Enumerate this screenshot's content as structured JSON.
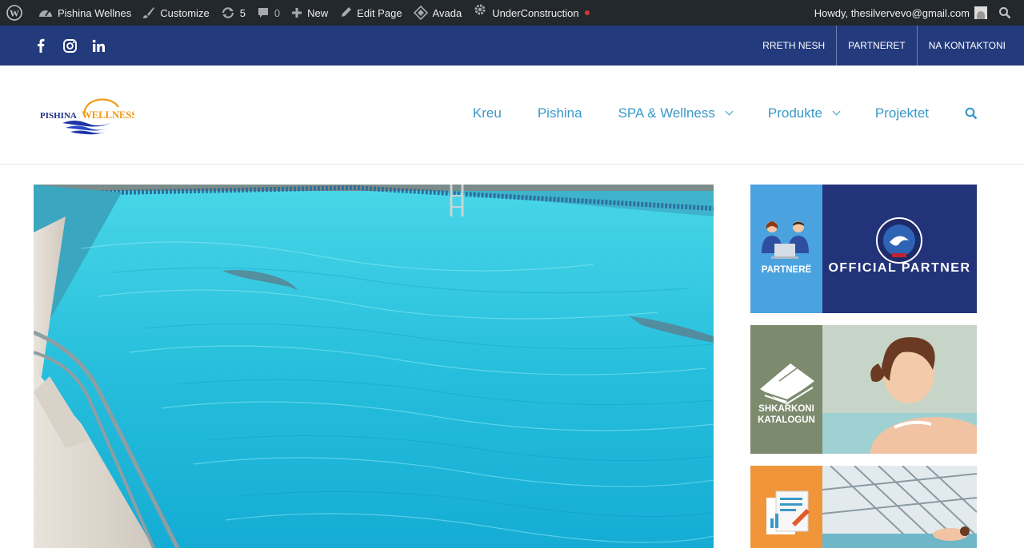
{
  "adminbar": {
    "site_name": "Pishina Wellnes",
    "customize": "Customize",
    "updates_count": "5",
    "comments_count": "0",
    "new_label": "New",
    "edit_page": "Edit Page",
    "avada": "Avada",
    "under_construction": "UnderConstruction",
    "howdy": "Howdy, thesilvervevo@gmail.com"
  },
  "topbar": {
    "social_icons": [
      "facebook-icon",
      "instagram-icon",
      "linkedin-icon"
    ],
    "nav": [
      "RRETH NESH",
      "PARTNERET",
      "NA KONTAKTONI"
    ]
  },
  "logo": {
    "text_left": "PISHINA",
    "text_right": "WELLNESS"
  },
  "mainnav": {
    "items": [
      "Kreu",
      "Pishina",
      "SPA & Wellness",
      "Produkte",
      "Projektet"
    ]
  },
  "sidebar": {
    "partner_label": "PARTNERË",
    "official_partner": "OFFICIAL PARTNER",
    "catalog_label_1": "SHKARKONI",
    "catalog_label_2": "KATALOGUN"
  },
  "colors": {
    "adminbar": "#23282d",
    "topbar": "#233a7c",
    "nav_link": "#3a98c7",
    "partner_blue": "#4aa3df",
    "official_navy": "#23337a",
    "catalog_grey": "#7c8a6e",
    "orange": "#f0953a"
  }
}
